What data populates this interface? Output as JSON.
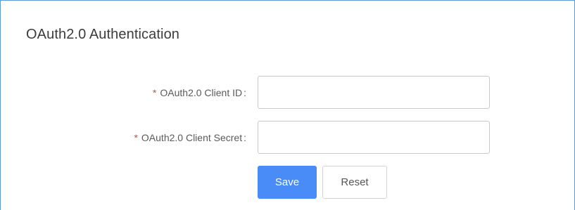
{
  "section": {
    "title": "OAuth2.0 Authentication"
  },
  "form": {
    "required_marker": "*",
    "fields": [
      {
        "label": "OAuth2.0 Client ID",
        "separator": ":",
        "value": "",
        "placeholder": ""
      },
      {
        "label": "OAuth2.0 Client Secret",
        "separator": ":",
        "value": "",
        "placeholder": ""
      }
    ]
  },
  "actions": {
    "save_label": "Save",
    "reset_label": "Reset"
  },
  "colors": {
    "frame_border": "#5b9bd5",
    "required": "#e0443e",
    "primary_button": "#4a8cf7"
  }
}
